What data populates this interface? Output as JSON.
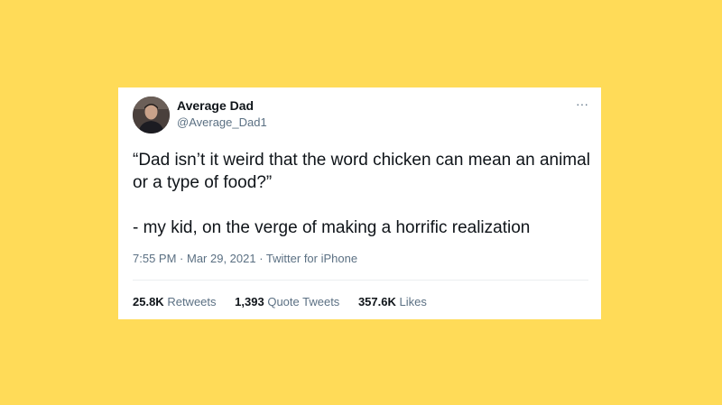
{
  "tweet": {
    "author": {
      "display_name": "Average Dad",
      "handle": "@Average_Dad1",
      "avatar_icon": "user-avatar"
    },
    "more_icon": "ellipsis-icon",
    "text": "“Dad isn’t it weird that the word chicken can mean an animal or a type of food?”\n\n- my kid, on the verge of making a horrific realization",
    "time": "7:55 PM",
    "date": "Mar 29, 2021",
    "source": "Twitter for iPhone",
    "separator": " · ",
    "stats": {
      "retweets": {
        "count": "25.8K",
        "label": "Retweets"
      },
      "quote_tweets": {
        "count": "1,393",
        "label": "Quote Tweets"
      },
      "likes": {
        "count": "357.6K",
        "label": "Likes"
      }
    }
  },
  "colors": {
    "background": "#FFDB58",
    "card": "#ffffff",
    "text_primary": "#0f1419",
    "text_secondary": "#5b7083"
  }
}
